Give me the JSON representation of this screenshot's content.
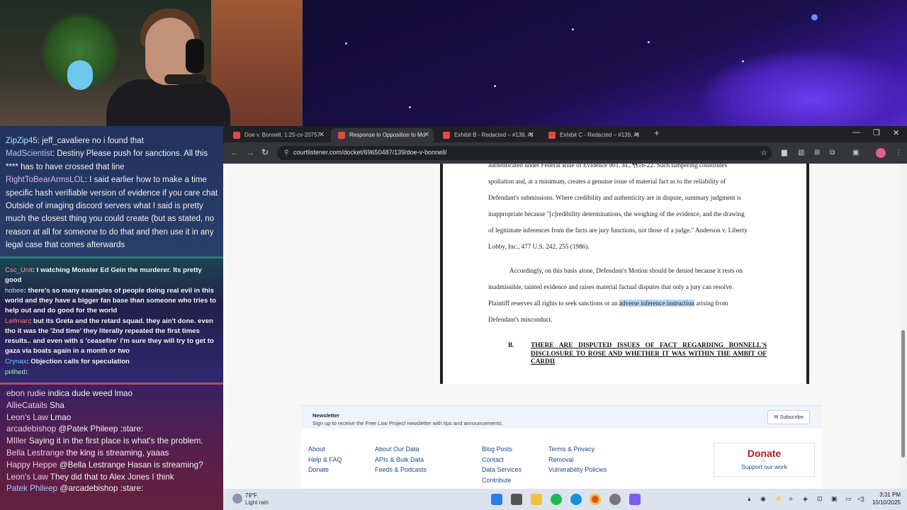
{
  "chat_top": [
    {
      "user": "ZipZip45",
      "color": "#a8e4ff",
      "text": ": jeff_cavaliere no i found that"
    },
    {
      "user": "MadScientist",
      "color": "#a8c8ff",
      "text": ": Destiny     Please push for sanctions. All this **** has to have crossed that line"
    },
    {
      "user": "RightToBearArmsLOL",
      "color": "#d9b3ff",
      "text": ": I said earlier how to make a time specific hash verifiable version of evidence if you care chat     Outside of imaging discord servers what I said is pretty much the closest thing you could create (but as stated, no reason at all for someone to do that and then use it in any legal case that comes afterwards"
    }
  ],
  "chat_mid": [
    {
      "user": "Csc_Unit",
      "color": "#ff9a9a",
      "text": ": I watching Monster Ed Gein the murderer. Its pretty good"
    },
    {
      "user": "hobee",
      "color": "#b3d4ff",
      "text": ": there's so many examples of people doing real evil in this world and they have a bigger fan base than someone who tries to help out and do good for the world"
    },
    {
      "user": "Leifman",
      "color": "#ff7a7a",
      "text": ": but its Greta and the retard squad. they ain't done. even tho it was the '2nd time' they literally repeated the first times results.. and even with s 'ceasefire' i'm sure they will try to get to gaza via boats again in a month or two"
    },
    {
      "user": "Crynax",
      "color": "#7ac8ff",
      "text": ":     Objection calls for speculation"
    },
    {
      "user": "pi4hed",
      "color": "#9cff9c",
      "text": ":"
    }
  ],
  "chat_bottom": [
    {
      "user": "ebon rudie",
      "color": "#f0c8e0",
      "text": " indica dude weed lmao"
    },
    {
      "user": "AllieCatails",
      "color": "#f0c8e0",
      "text": " Sha"
    },
    {
      "user": "Leon's Law",
      "color": "#f0c8e0",
      "text": " Lmao"
    },
    {
      "user": "arcadebishop",
      "color": "#f0c8e0",
      "text": " @Patek Phileep :stare:"
    },
    {
      "user": "MIller",
      "color": "#f0c8e0",
      "text": " Saying it in the first place is what's the problem."
    },
    {
      "user": "Bella Lestrange",
      "color": "#f0c8e0",
      "text": " the king is streaming, yaaas"
    },
    {
      "user": "Happy Heppe",
      "color": "#f0c8e0",
      "text": " @Bella Lestrange Hasan is streaming?"
    },
    {
      "user": "Leon's Law",
      "color": "#f0c8e0",
      "text": " They did that to Alex Jones I think"
    },
    {
      "user": "Patek Phileep",
      "color": "#a8c8ff",
      "text": " @arcadebishop :stare:"
    }
  ],
  "browser": {
    "tabs": [
      {
        "title": "Doe v. Bonnell, 1:25-cv-20757 -"
      },
      {
        "title": "Response in Opposition to Mo"
      },
      {
        "title": "Exhibit B - Redacted – #139, At"
      },
      {
        "title": "Exhibit C - Redacted – #139, At"
      }
    ],
    "url": "courtlistener.com/docket/69650487/139/doe-v-bonnell/"
  },
  "document": {
    "p1_lines": [
      "authenticated under Federal Rule of Evidence 901. Id., ¶¶16-22. Such tampering constitutes",
      "spoliation and, at a minimum, creates a genuine issue of material fact as to the reliability of",
      "Defendant's submissions. Where credibility and authenticity are in dispute, summary judgment is",
      "inappropriate because \"[c]redibility determinations, the weighing of the evidence, and the drawing",
      "of legitimate inferences from the facts are jury functions, not those of a judge.\" Anderson v. Liberty",
      "Lobby, Inc., 477 U.S. 242, 255 (1986)."
    ],
    "p2_line1": "Accordingly, on this basis alone, Defendant's Motion should be denied because it rests on",
    "p2_line2": "inadmissible, tainted evidence and raises material factual disputes that only a jury can resolve.",
    "p2_line3_pre": "Plaintiff reserves all rights to seek sanctions or an",
    "p2_highlight": "adverse inference instruction",
    "p2_line3_post": "arising from",
    "p2_line4": "Defendant's misconduct.",
    "section_label": "B.",
    "section_heading": "THERE ARE DISPUTED ISSUES OF FACT REGARDING BONNELL'S DISCLOSURE TO ROSE AND WHETHER IT WAS WITHIN THE AMBIT OF CARDII"
  },
  "footer": {
    "newsletter_title": "Newsletter",
    "newsletter_sub": "Sign up to receive the Free Law Project newsletter with tips and announcements.",
    "subscribe_label": "Subscribe",
    "col1": [
      "About",
      "Help & FAQ",
      "Donate"
    ],
    "col2": [
      "About Our Data",
      "APIs & Bulk Data",
      "Feeds & Podcasts"
    ],
    "col3": [
      "Blog Posts",
      "Contact",
      "Data Services",
      "Contribute"
    ],
    "col4": [
      "Terms & Privacy",
      "Removal",
      "Vulnerability Policies"
    ],
    "donate_title": "Donate",
    "donate_to": "to",
    "donate_sub": "Support our work"
  },
  "taskbar": {
    "temp": "79°F",
    "condition": "Light rain",
    "time": "3:31 PM",
    "date": "10/10/2025"
  }
}
